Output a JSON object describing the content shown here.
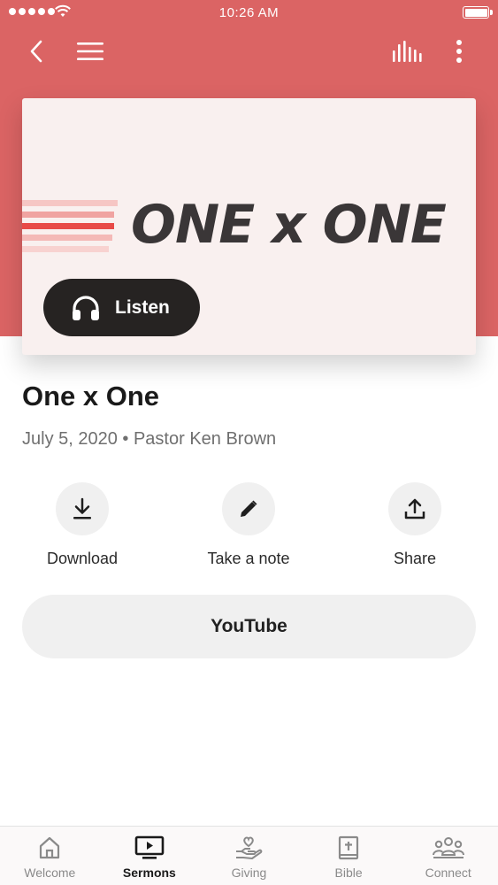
{
  "status_bar": {
    "time": "10:26 AM"
  },
  "colors": {
    "brand": "#db6464",
    "art_background": "#f9f0ef",
    "art_text": "#3a3637",
    "listen_button": "#262322",
    "stripe_colors": [
      "#f6c6c4",
      "#f0a3a1",
      "#e84a47",
      "#f4b9b7",
      "#f8d2d0"
    ]
  },
  "nav": {
    "back_icon": "chevron-left-icon",
    "menu_icon": "hamburger-menu-icon",
    "audio_icon": "audio-bars-icon",
    "more_icon": "more-vertical-icon"
  },
  "artwork": {
    "title": "ONE x ONE"
  },
  "listen": {
    "label": "Listen",
    "icon": "headphones-icon"
  },
  "sermon": {
    "title": "One x One",
    "meta": "July 5, 2020 • Pastor Ken Brown"
  },
  "actions": [
    {
      "label": "Download",
      "icon": "download-icon"
    },
    {
      "label": "Take a note",
      "icon": "pencil-icon"
    },
    {
      "label": "Share",
      "icon": "share-icon"
    }
  ],
  "youtube": {
    "label": "YouTube"
  },
  "tabs": [
    {
      "label": "Welcome",
      "icon": "home-icon",
      "active": false
    },
    {
      "label": "Sermons",
      "icon": "tv-play-icon",
      "active": true
    },
    {
      "label": "Giving",
      "icon": "giving-heart-hand-icon",
      "active": false
    },
    {
      "label": "Bible",
      "icon": "bible-icon",
      "active": false
    },
    {
      "label": "Connect",
      "icon": "people-group-icon",
      "active": false
    }
  ]
}
